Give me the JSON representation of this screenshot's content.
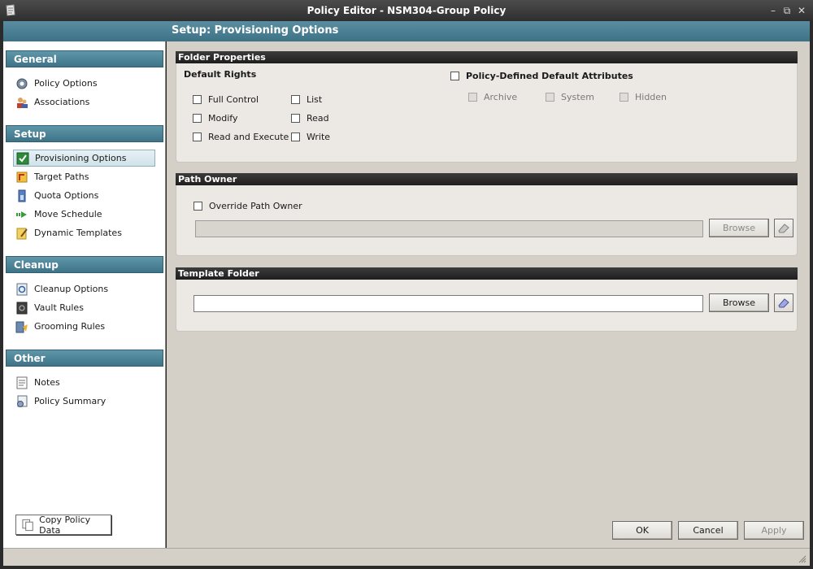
{
  "window": {
    "title": "Policy Editor - NSM304-Group Policy"
  },
  "header": {
    "title": "Setup: Provisioning Options"
  },
  "sidebar": {
    "sections": [
      {
        "title": "General",
        "items": [
          {
            "label": "Policy Options",
            "icon": "gear-icon"
          },
          {
            "label": "Associations",
            "icon": "users-icon"
          }
        ]
      },
      {
        "title": "Setup",
        "items": [
          {
            "label": "Provisioning Options",
            "icon": "checkbox-icon",
            "selected": true
          },
          {
            "label": "Target Paths",
            "icon": "target-path-icon"
          },
          {
            "label": "Quota Options",
            "icon": "quota-icon"
          },
          {
            "label": "Move Schedule",
            "icon": "move-arrow-icon"
          },
          {
            "label": "Dynamic Templates",
            "icon": "template-icon"
          }
        ]
      },
      {
        "title": "Cleanup",
        "items": [
          {
            "label": "Cleanup Options",
            "icon": "cleanup-icon"
          },
          {
            "label": "Vault Rules",
            "icon": "vault-icon"
          },
          {
            "label": "Grooming Rules",
            "icon": "broom-icon"
          }
        ]
      },
      {
        "title": "Other",
        "items": [
          {
            "label": "Notes",
            "icon": "notes-icon"
          },
          {
            "label": "Policy Summary",
            "icon": "summary-icon"
          }
        ]
      }
    ],
    "copy_button": "Copy Policy Data"
  },
  "folder_properties": {
    "title": "Folder Properties",
    "default_rights_label": "Default Rights",
    "rights": [
      {
        "label": "Full Control",
        "checked": false
      },
      {
        "label": "Modify",
        "checked": false
      },
      {
        "label": "Read and Execute",
        "checked": false
      },
      {
        "label": "List",
        "checked": false
      },
      {
        "label": "Read",
        "checked": false
      },
      {
        "label": "Write",
        "checked": false
      }
    ],
    "policy_defined_label": "Policy-Defined Default Attributes",
    "attributes": [
      {
        "label": "Archive",
        "checked": false
      },
      {
        "label": "System",
        "checked": false
      },
      {
        "label": "Hidden",
        "checked": false
      }
    ]
  },
  "path_owner": {
    "title": "Path Owner",
    "override_label": "Override Path Owner",
    "value": "",
    "browse_label": "Browse"
  },
  "template_folder": {
    "title": "Template Folder",
    "value": "",
    "browse_label": "Browse"
  },
  "footer": {
    "ok": "OK",
    "cancel": "Cancel",
    "apply": "Apply"
  }
}
